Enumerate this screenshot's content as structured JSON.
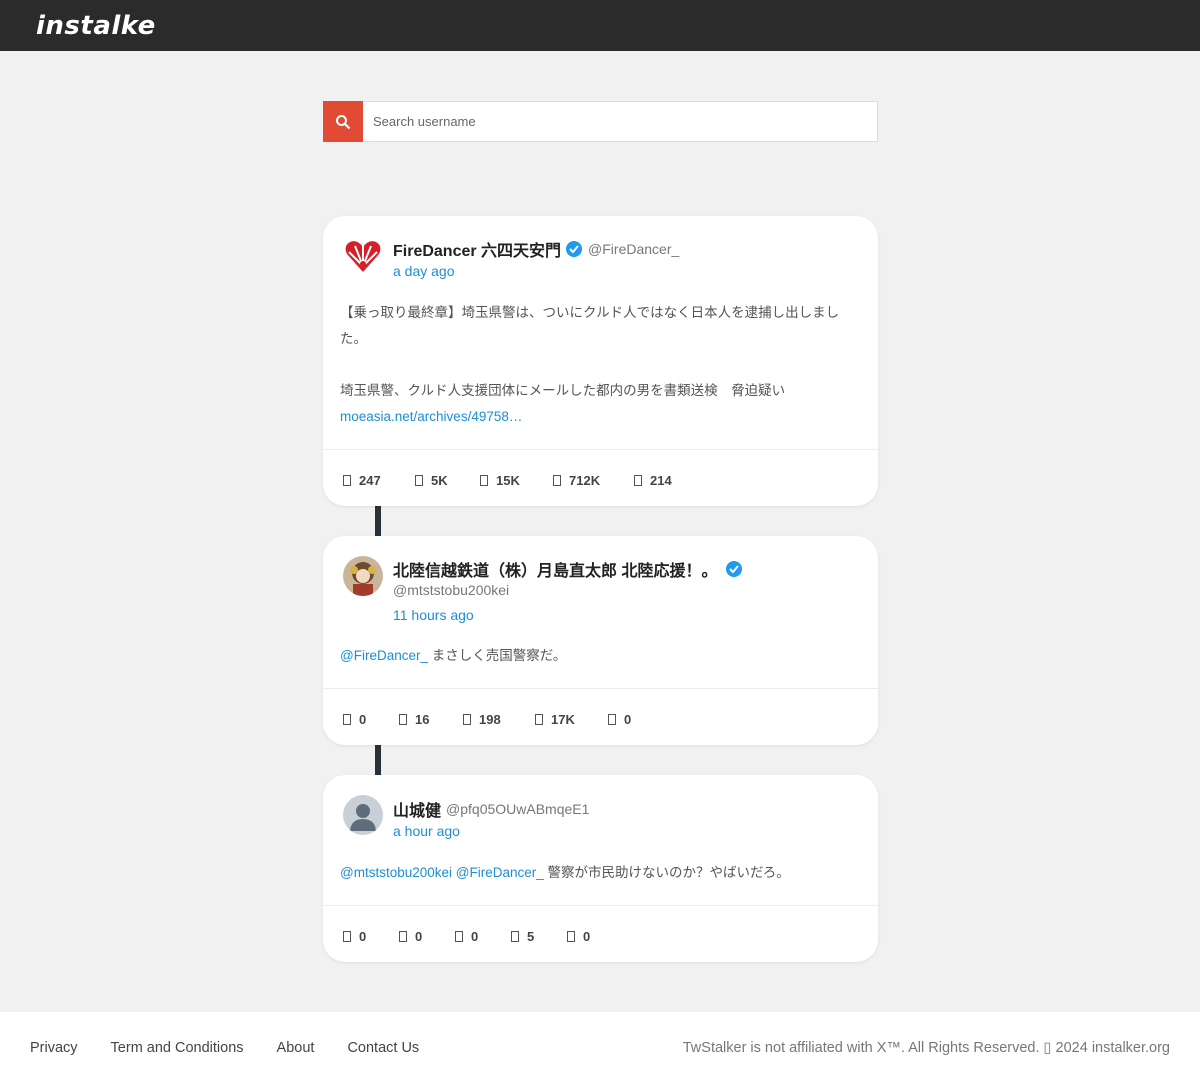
{
  "header": {
    "logo_text": "instalker"
  },
  "search": {
    "placeholder": "Search username",
    "icon": "search-icon"
  },
  "tweets": [
    {
      "name": "FireDancer 六四天安門",
      "handle": "@FireDancer_",
      "verified": true,
      "time": "a day ago",
      "text_line1": "【乗っ取り最終章】埼玉県警は、ついにクルド人ではなく日本人を逮捕し出しまし",
      "text_line2": "た。",
      "text_line3": "埼玉県警、クルド人支援団体にメールした都内の男を書類送検　脅迫疑い",
      "link": "moeasia.net/archives/49758…",
      "stats": [
        "247",
        "5K",
        "15K",
        "712K",
        "214"
      ]
    },
    {
      "name": "北陸信越鉄道（株）月島直太郎 北陸応援！。",
      "handle": "@mtststobu200kei",
      "verified": true,
      "time": "11 hours ago",
      "mention1": "@FireDancer_",
      "text": " まさしく売国警察だ。",
      "stats": [
        "0",
        "16",
        "198",
        "17K",
        "0"
      ]
    },
    {
      "name": "山城健",
      "handle": "@pfq05OUwABmqeE1",
      "verified": false,
      "time": "a hour ago",
      "mention1": "@mtststobu200kei",
      "mention2": "@FireDancer_",
      "text": " 警察が市民助けないのか？やばいだろ。",
      "stats": [
        "0",
        "0",
        "0",
        "5",
        "0"
      ]
    }
  ],
  "footer": {
    "links": [
      "Privacy",
      "Term and Conditions",
      "About",
      "Contact Us"
    ],
    "copyright": "TwStalker is not affiliated with X™. All Rights Reserved. ▯ 2024 instalker.org"
  },
  "colors": {
    "accent": "#e14b33",
    "link": "#1d8ed6",
    "topbar": "#2b2b2b",
    "verified": "#1d9bf0"
  }
}
